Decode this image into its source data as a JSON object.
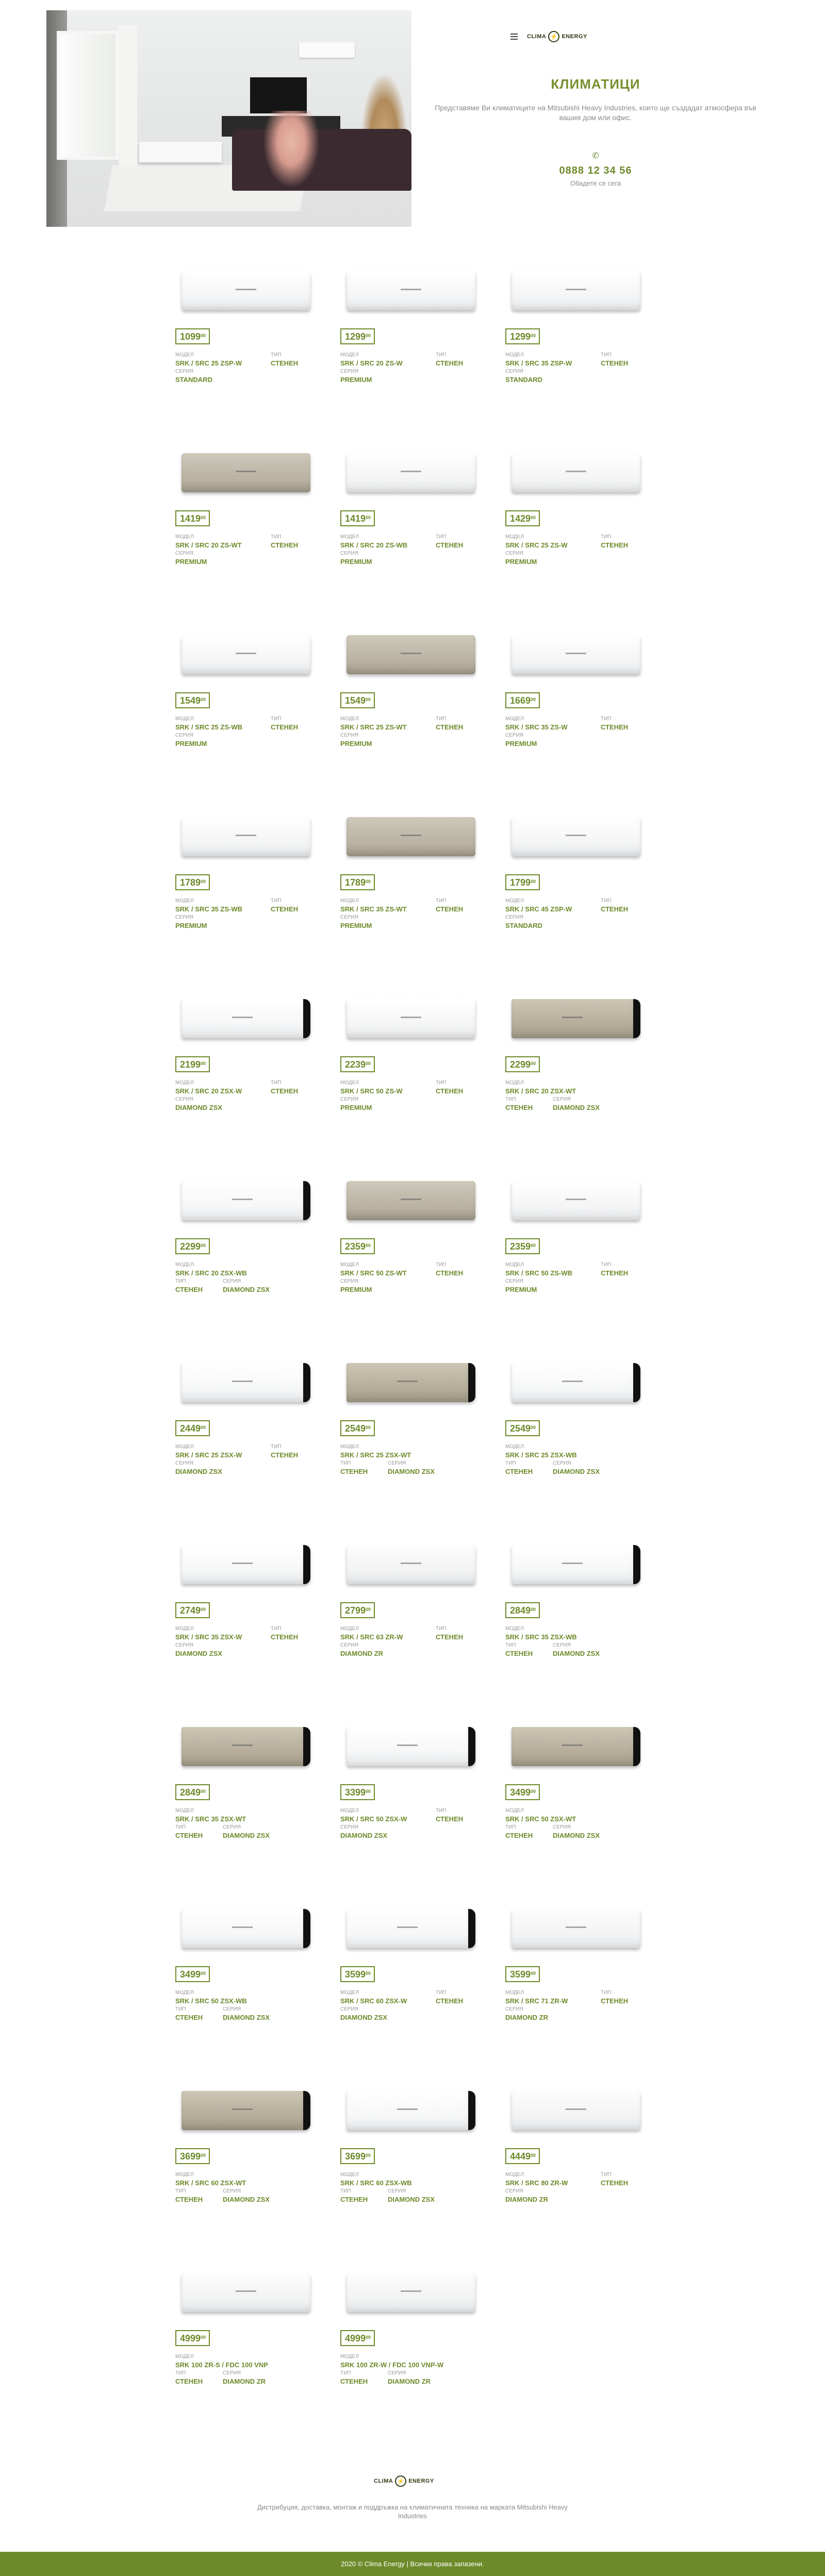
{
  "header": {
    "logo_text_left": "CLIMA",
    "logo_text_right": "ENERGY",
    "title": "КЛИМАТИЦИ",
    "description": "Представяме Ви климатиците на Mitsubishi Heavy Industries, които ще създадат атмосфера във вашия дом или офис.",
    "phone": "0888 12 34 56",
    "phone_sub": "Обадете се сега"
  },
  "labels": {
    "model": "МОДЕЛ",
    "type": "ТИП",
    "series": "СЕРИЯ"
  },
  "products": [
    {
      "price": "1099",
      "cents": "00",
      "model": "SRK / SRC 25 ZSP-W",
      "type": "СТЕНЕН",
      "series": "STANDARD",
      "style": "white",
      "layout": "A"
    },
    {
      "price": "1299",
      "cents": "00",
      "model": "SRK / SRC 20 ZS-W",
      "type": "СТЕНЕН",
      "series": "PREMIUM",
      "style": "white",
      "layout": "A"
    },
    {
      "price": "1299",
      "cents": "00",
      "model": "SRK / SRC 35 ZSP-W",
      "type": "СТЕНЕН",
      "series": "STANDARD",
      "style": "white",
      "layout": "A"
    },
    {
      "price": "1419",
      "cents": "00",
      "model": "SRK / SRC 20 ZS-WT",
      "type": "СТЕНЕН",
      "series": "PREMIUM",
      "style": "beige",
      "layout": "A"
    },
    {
      "price": "1419",
      "cents": "00",
      "model": "SRK / SRC 20 ZS-WB",
      "type": "СТЕНЕН",
      "series": "PREMIUM",
      "style": "white",
      "layout": "A"
    },
    {
      "price": "1429",
      "cents": "00",
      "model": "SRK / SRC 25 ZS-W",
      "type": "СТЕНЕН",
      "series": "PREMIUM",
      "style": "white",
      "layout": "A"
    },
    {
      "price": "1549",
      "cents": "00",
      "model": "SRK / SRC 25 ZS-WB",
      "type": "СТЕНЕН",
      "series": "PREMIUM",
      "style": "white",
      "layout": "A"
    },
    {
      "price": "1549",
      "cents": "00",
      "model": "SRK / SRC 25 ZS-WT",
      "type": "СТЕНЕН",
      "series": "PREMIUM",
      "style": "beige",
      "layout": "A"
    },
    {
      "price": "1669",
      "cents": "00",
      "model": "SRK / SRC 35 ZS-W",
      "type": "СТЕНЕН",
      "series": "PREMIUM",
      "style": "white",
      "layout": "A"
    },
    {
      "price": "1789",
      "cents": "00",
      "model": "SRK / SRC 35 ZS-WB",
      "type": "СТЕНЕН",
      "series": "PREMIUM",
      "style": "white",
      "layout": "A"
    },
    {
      "price": "1789",
      "cents": "00",
      "model": "SRK / SRC 35 ZS-WT",
      "type": "СТЕНЕН",
      "series": "PREMIUM",
      "style": "beige",
      "layout": "A"
    },
    {
      "price": "1799",
      "cents": "00",
      "model": "SRK / SRC 45 ZSP-W",
      "type": "СТЕНЕН",
      "series": "STANDARD",
      "style": "white",
      "layout": "A"
    },
    {
      "price": "2199",
      "cents": "00",
      "model": "SRK / SRC 20 ZSX-W",
      "type": "СТЕНЕН",
      "series": "DIAMOND ZSX",
      "style": "zsx-white",
      "layout": "A"
    },
    {
      "price": "2239",
      "cents": "00",
      "model": "SRK / SRC 50 ZS-W",
      "type": "СТЕНЕН",
      "series": "PREMIUM",
      "style": "white",
      "layout": "A"
    },
    {
      "price": "2299",
      "cents": "00",
      "model": "SRK / SRC 20 ZSX-WT",
      "type": "СТЕНЕН",
      "series": "DIAMOND ZSX",
      "style": "zsx-beige",
      "layout": "B"
    },
    {
      "price": "2299",
      "cents": "00",
      "model": "SRK / SRC 20 ZSX-WB",
      "type": "СТЕНЕН",
      "series": "DIAMOND ZSX",
      "style": "zsx-white",
      "layout": "B"
    },
    {
      "price": "2359",
      "cents": "00",
      "model": "SRK / SRC 50 ZS-WT",
      "type": "СТЕНЕН",
      "series": "PREMIUM",
      "style": "beige",
      "layout": "A"
    },
    {
      "price": "2359",
      "cents": "00",
      "model": "SRK / SRC 50 ZS-WB",
      "type": "СТЕНЕН",
      "series": "PREMIUM",
      "style": "white",
      "layout": "A"
    },
    {
      "price": "2449",
      "cents": "00",
      "model": "SRK / SRC 25 ZSX-W",
      "type": "СТЕНЕН",
      "series": "DIAMOND ZSX",
      "style": "zsx-white",
      "layout": "A"
    },
    {
      "price": "2549",
      "cents": "00",
      "model": "SRK / SRC 25 ZSX-WT",
      "type": "СТЕНЕН",
      "series": "DIAMOND ZSX",
      "style": "zsx-beige",
      "layout": "B"
    },
    {
      "price": "2549",
      "cents": "00",
      "model": "SRK / SRC 25 ZSX-WB",
      "type": "СТЕНЕН",
      "series": "DIAMOND ZSX",
      "style": "zsx-white",
      "layout": "B"
    },
    {
      "price": "2749",
      "cents": "00",
      "model": "SRK / SRC 35 ZSX-W",
      "type": "СТЕНЕН",
      "series": "DIAMOND ZSX",
      "style": "zsx-white",
      "layout": "A"
    },
    {
      "price": "2799",
      "cents": "00",
      "model": "SRK / SRC 63 ZR-W",
      "type": "СТЕНЕН",
      "series": "DIAMOND ZR",
      "style": "zr",
      "layout": "A"
    },
    {
      "price": "2849",
      "cents": "00",
      "model": "SRK / SRC 35 ZSX-WB",
      "type": "СТЕНЕН",
      "series": "DIAMOND ZSX",
      "style": "zsx-white",
      "layout": "B"
    },
    {
      "price": "2849",
      "cents": "00",
      "model": "SRK / SRC 35 ZSX-WT",
      "type": "СТЕНЕН",
      "series": "DIAMOND ZSX",
      "style": "zsx-beige",
      "layout": "B"
    },
    {
      "price": "3399",
      "cents": "00",
      "model": "SRK / SRC 50 ZSX-W",
      "type": "СТЕНЕН",
      "series": "DIAMOND ZSX",
      "style": "zsx-white",
      "layout": "A"
    },
    {
      "price": "3499",
      "cents": "00",
      "model": "SRK / SRC 50 ZSX-WT",
      "type": "СТЕНЕН",
      "series": "DIAMOND ZSX",
      "style": "zsx-beige",
      "layout": "B"
    },
    {
      "price": "3499",
      "cents": "00",
      "model": "SRK / SRC 50 ZSX-WB",
      "type": "СТЕНЕН",
      "series": "DIAMOND ZSX",
      "style": "zsx-white",
      "layout": "B"
    },
    {
      "price": "3599",
      "cents": "00",
      "model": "SRK / SRC 60 ZSX-W",
      "type": "СТЕНЕН",
      "series": "DIAMOND ZSX",
      "style": "zsx-white",
      "layout": "A"
    },
    {
      "price": "3599",
      "cents": "00",
      "model": "SRK / SRC 71 ZR-W",
      "type": "СТЕНЕН",
      "series": "DIAMOND ZR",
      "style": "zr",
      "layout": "A"
    },
    {
      "price": "3699",
      "cents": "00",
      "model": "SRK / SRC 60 ZSX-WT",
      "type": "СТЕНЕН",
      "series": "DIAMOND ZSX",
      "style": "zsx-beige",
      "layout": "B"
    },
    {
      "price": "3699",
      "cents": "00",
      "model": "SRK / SRC 60 ZSX-WB",
      "type": "СТЕНЕН",
      "series": "DIAMOND ZSX",
      "style": "zsx-white",
      "layout": "B"
    },
    {
      "price": "4449",
      "cents": "00",
      "model": "SRK / SRC 80 ZR-W",
      "type": "СТЕНЕН",
      "series": "DIAMOND ZR",
      "style": "zr",
      "layout": "A"
    },
    {
      "price": "4999",
      "cents": "00",
      "model": "SRK 100 ZR-S / FDC 100 VNP",
      "type": "СТЕНЕН",
      "series": "DIAMOND ZR",
      "style": "zr",
      "layout": "B"
    },
    {
      "price": "4999",
      "cents": "00",
      "model": "SRK 100 ZR-W / FDC 100 VNP-W",
      "type": "СТЕНЕН",
      "series": "DIAMOND ZR",
      "style": "zr",
      "layout": "B"
    }
  ],
  "footer": {
    "logo_text_left": "CLIMA",
    "logo_text_right": "ENERGY",
    "description": "Дистрибуция, доставка, монтаж и поддръжка на климатичната техника на марката Mitsubishi Heavy Industries",
    "copyright": "2020 © Clima Energy | Всички права запазени."
  },
  "colors": {
    "accent": "#6d8a2a",
    "footer_bar": "#6d8a2a"
  }
}
